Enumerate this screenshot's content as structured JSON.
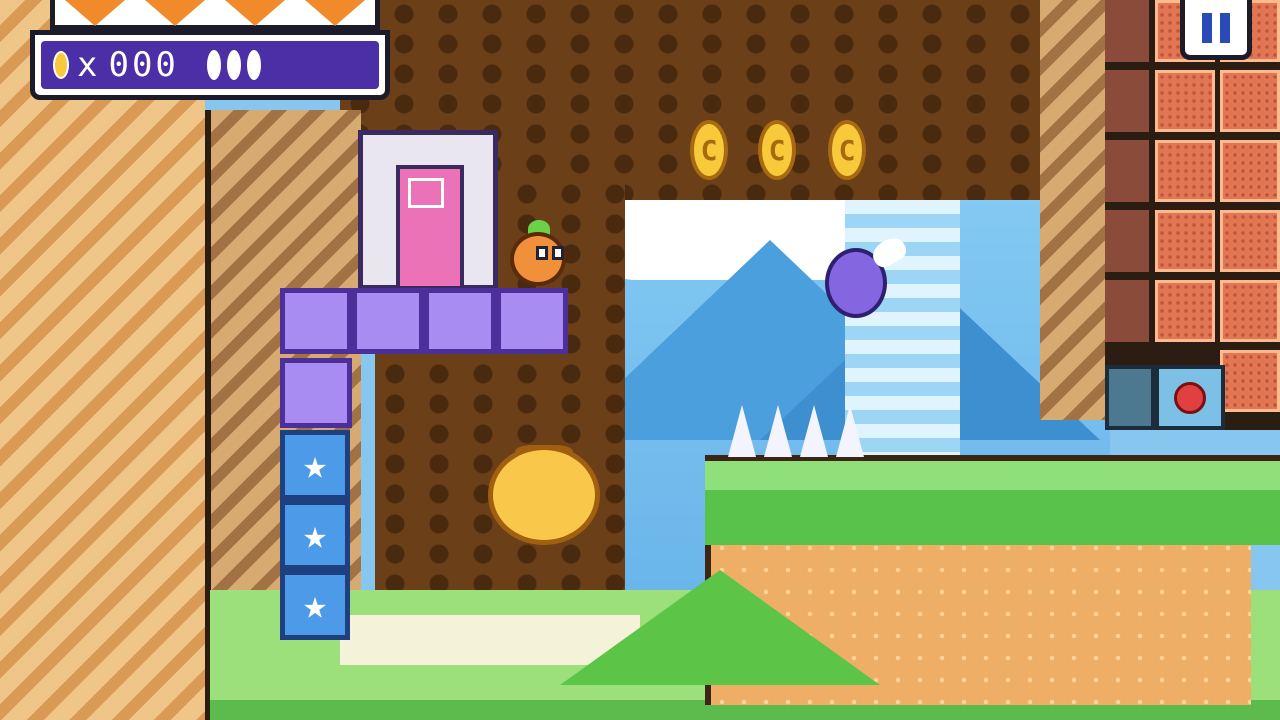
{
  "hud": {
    "hearts": 4,
    "coin_multiplier": "x",
    "coin_count": "000",
    "gems": 3
  },
  "level": {
    "coins_visible": 3,
    "coin_glyph": "C",
    "spikes": 4,
    "star_glyph": "★"
  },
  "colors": {
    "hud_panel": "#4b2fa6",
    "heart": "#f08a2a",
    "coin": "#f7c93b",
    "door": "#ec72b8"
  },
  "icons": [
    "heart-icon",
    "coin-icon",
    "gem-icon",
    "pause-icon"
  ]
}
